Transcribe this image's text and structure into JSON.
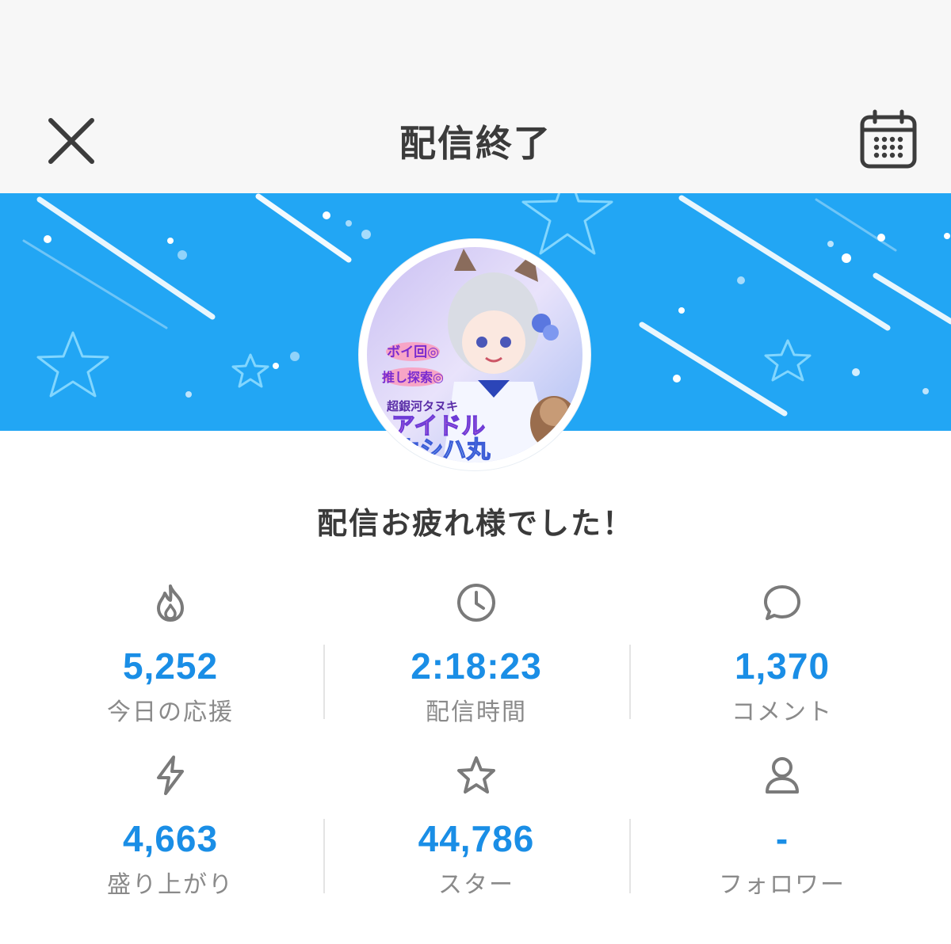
{
  "header": {
    "title": "配信終了",
    "close_icon": "close-icon",
    "calendar_icon": "calendar-icon"
  },
  "banner": {
    "background_color": "#22a6f4",
    "avatar_text": {
      "line1": "ボイ回◎",
      "line2": "推し探索◎",
      "line3": "超銀河タヌキ",
      "line4": "アイドル",
      "line5": "ホシハ丸"
    }
  },
  "message": "配信お疲れ様でした！",
  "stats": [
    {
      "icon": "flame-icon",
      "value": "5,252",
      "label": "今日の応援"
    },
    {
      "icon": "clock-icon",
      "value": "2:18:23",
      "label": "配信時間"
    },
    {
      "icon": "comment-icon",
      "value": "1,370",
      "label": "コメント"
    },
    {
      "icon": "lightning-icon",
      "value": "4,663",
      "label": "盛り上がり"
    },
    {
      "icon": "star-icon",
      "value": "44,786",
      "label": "スター"
    },
    {
      "icon": "user-icon",
      "value": "-",
      "label": "フォロワー"
    }
  ],
  "colors": {
    "accent": "#1a8ee6",
    "label": "#8a8a8a",
    "icon": "#7a7a7a"
  }
}
